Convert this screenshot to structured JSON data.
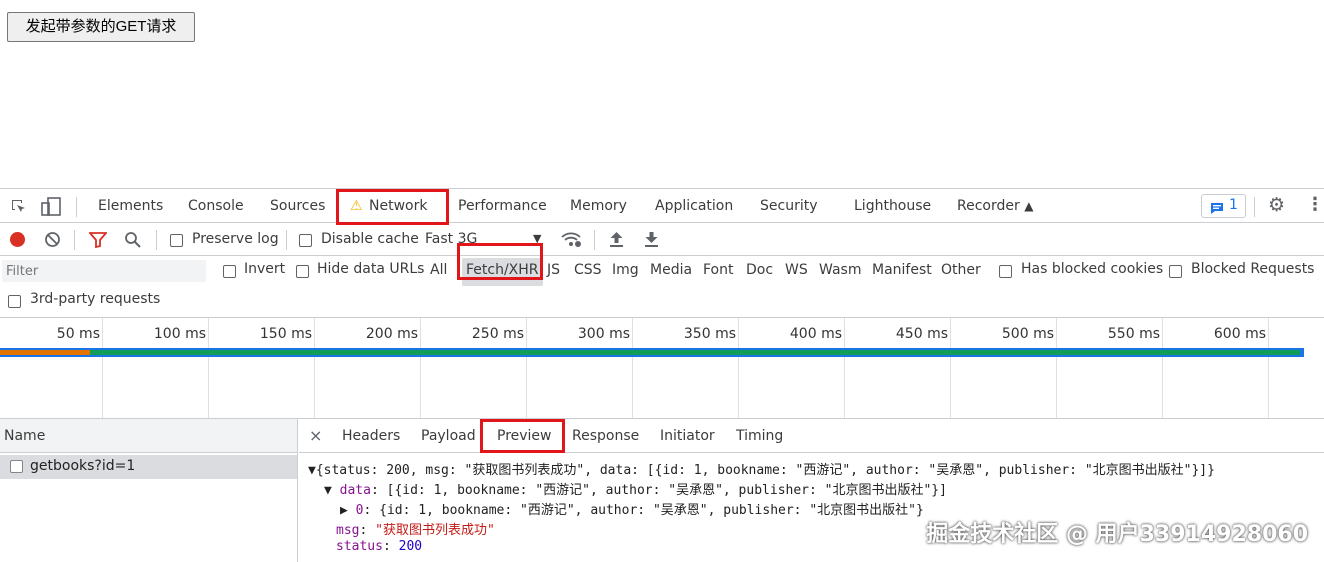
{
  "page": {
    "get_button_label": "发起带参数的GET请求"
  },
  "tabs": {
    "elements": "Elements",
    "console": "Console",
    "sources": "Sources",
    "network": "Network",
    "performance": "Performance",
    "memory": "Memory",
    "application": "Application",
    "security": "Security",
    "lighthouse": "Lighthouse",
    "recorder": "Recorder",
    "issues_count": "1"
  },
  "toolbar": {
    "preserve_log": "Preserve log",
    "disable_cache": "Disable cache",
    "throttling": "Fast 3G"
  },
  "filter": {
    "placeholder": "Filter",
    "invert": "Invert",
    "hide_data_urls": "Hide data URLs",
    "types": [
      "All",
      "Fetch/XHR",
      "JS",
      "CSS",
      "Img",
      "Media",
      "Font",
      "Doc",
      "WS",
      "Wasm",
      "Manifest",
      "Other"
    ],
    "has_blocked_cookies": "Has blocked cookies",
    "blocked_requests": "Blocked Requests",
    "third_party": "3rd-party requests"
  },
  "timeline": {
    "ticks": [
      "50 ms",
      "100 ms",
      "150 ms",
      "200 ms",
      "250 ms",
      "300 ms",
      "350 ms",
      "400 ms",
      "450 ms",
      "500 ms",
      "550 ms",
      "600 ms"
    ]
  },
  "requests": {
    "header": "Name",
    "rows": [
      "getbooks?id=1"
    ]
  },
  "detail": {
    "close": "×",
    "tabs": [
      "Headers",
      "Payload",
      "Preview",
      "Response",
      "Initiator",
      "Timing"
    ],
    "line1": "{status: 200, msg: \"获取图书列表成功\", data: [{id: 1, bookname: \"西游记\", author: \"吴承恩\", publisher: \"北京图书出版社\"}]}",
    "data_key": "data",
    "data_summary": "[{id: 1, bookname: \"西游记\", author: \"吴承恩\", publisher: \"北京图书出版社\"}]",
    "item_key": "0",
    "item_summary": "{id: 1, bookname: \"西游记\", author: \"吴承恩\", publisher: \"北京图书出版社\"}",
    "msg_key": "msg",
    "msg_value": "\"获取图书列表成功\"",
    "status_key": "status",
    "status_value": "200"
  },
  "watermark": "掘金技术社区 @ 用户33914928060",
  "colors": {
    "highlight_box": "#e1161b",
    "waterfall_green": "#0f9d58",
    "waterfall_orange": "#e37400",
    "waterfall_blue": "#1a73e8"
  }
}
